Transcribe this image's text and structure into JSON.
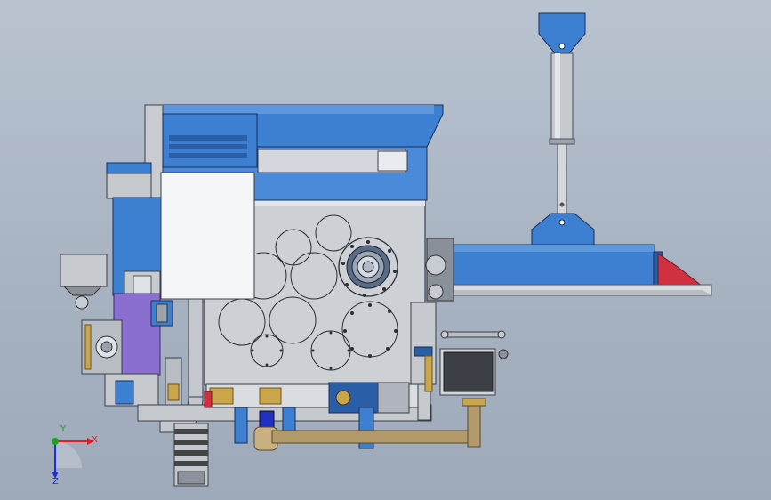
{
  "viewport": {
    "background_top": "#b9c3d0",
    "background_bottom": "#9ea9b9"
  },
  "model": {
    "description_colors": {
      "blue": "#3d7fd0",
      "blue_dark": "#2a5fa8",
      "grey_body": "#c8cbd0",
      "white_panel": "#f4f6f8",
      "purple": "#8a6fd0",
      "red": "#d03040",
      "gold": "#c9a64a",
      "brown_frame": "#b39a6a",
      "dark_screen": "#3c4046"
    }
  },
  "triad": {
    "x_label": "X",
    "y_label": "Y",
    "z_label": "Z",
    "x_color": "#e02020",
    "y_color": "#20a020",
    "z_color": "#2030d0"
  }
}
